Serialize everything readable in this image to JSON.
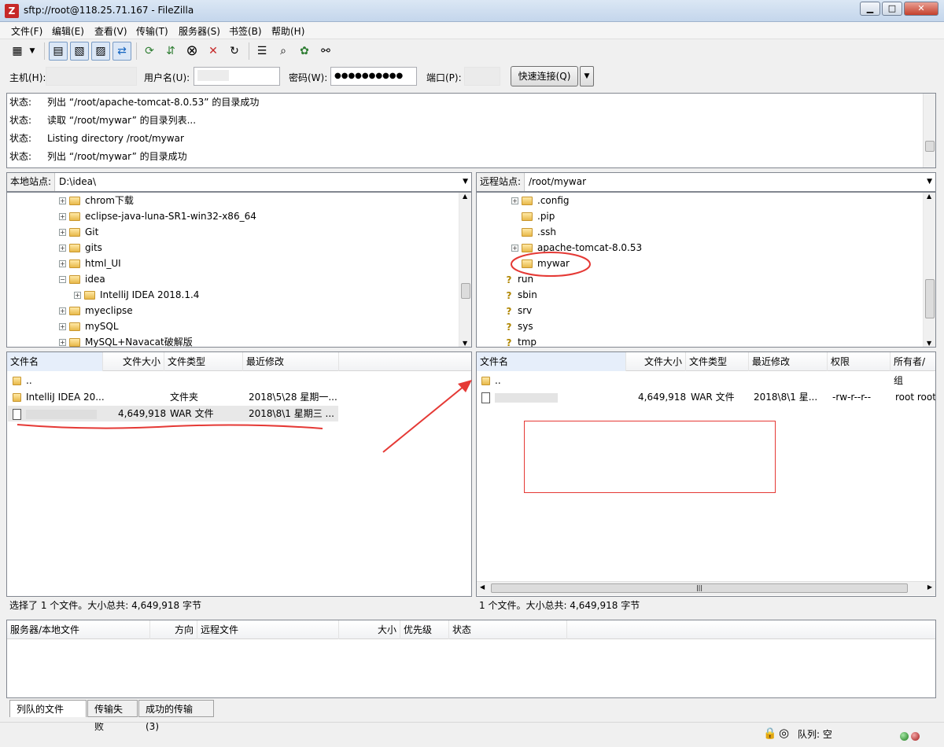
{
  "window": {
    "title": "sftp://root@118.25.71.167 - FileZilla"
  },
  "menu": [
    "文件(F)",
    "编辑(E)",
    "查看(V)",
    "传输(T)",
    "服务器(S)",
    "书签(B)",
    "帮助(H)"
  ],
  "quickconnect": {
    "host_label": "主机(H):",
    "user_label": "用户名(U):",
    "pass_label": "密码(W):",
    "pass_value": "●●●●●●●●●●",
    "port_label": "端口(P):",
    "button": "快速连接(Q)"
  },
  "log": [
    {
      "k": "状态:",
      "v": "列出 “/root/apache-tomcat-8.0.53” 的目录成功"
    },
    {
      "k": "状态:",
      "v": "读取 “/root/mywar” 的目录列表..."
    },
    {
      "k": "状态:",
      "v": "Listing directory /root/mywar"
    },
    {
      "k": "状态:",
      "v": "列出 “/root/mywar” 的目录成功"
    }
  ],
  "local": {
    "site_label": "本地站点:",
    "path": "D:\\idea\\",
    "tree": [
      "chrom下载",
      "eclipse-java-luna-SR1-win32-x86_64",
      "Git",
      "gits",
      "html_UI",
      "idea",
      "IntelliJ IDEA 2018.1.4",
      "myeclipse",
      "mySQL",
      "MySQL+Navacat破解版"
    ],
    "columns": [
      "文件名",
      "文件大小",
      "文件类型",
      "最近修改"
    ],
    "rows": [
      {
        "name": "..",
        "size": "",
        "type": "",
        "mod": ""
      },
      {
        "name": "IntelliJ IDEA 20...",
        "size": "",
        "type": "文件夹",
        "mod": "2018\\5\\28 星期一..."
      },
      {
        "name": "",
        "size": "4,649,918",
        "type": "WAR 文件",
        "mod": "2018\\8\\1 星期三 ..."
      }
    ],
    "status": "选择了 1 个文件。大小总共: 4,649,918 字节"
  },
  "remote": {
    "site_label": "远程站点:",
    "path": "/root/mywar",
    "tree": [
      ".config",
      ".pip",
      ".ssh",
      "apache-tomcat-8.0.53",
      "mywar",
      "run",
      "sbin",
      "srv",
      "sys",
      "tmp"
    ],
    "columns": [
      "文件名",
      "文件大小",
      "文件类型",
      "最近修改",
      "权限",
      "所有者/组"
    ],
    "rows": [
      {
        "name": "..",
        "size": "",
        "type": "",
        "mod": "",
        "perm": "",
        "owner": ""
      },
      {
        "name": "",
        "size": "4,649,918",
        "type": "WAR 文件",
        "mod": "2018\\8\\1 星...",
        "perm": "-rw-r--r--",
        "owner": "root root"
      }
    ],
    "status": "1 个文件。大小总共: 4,649,918 字节"
  },
  "queue": {
    "columns": [
      "服务器/本地文件",
      "方向",
      "远程文件",
      "大小",
      "优先级",
      "状态"
    ],
    "tabs": [
      "列队的文件",
      "传输失败",
      "成功的传输 (3)"
    ]
  },
  "footer": {
    "queue": "队列: 空"
  },
  "colors": {
    "annotation": "#e53935",
    "selection": "#e8e8e8"
  }
}
